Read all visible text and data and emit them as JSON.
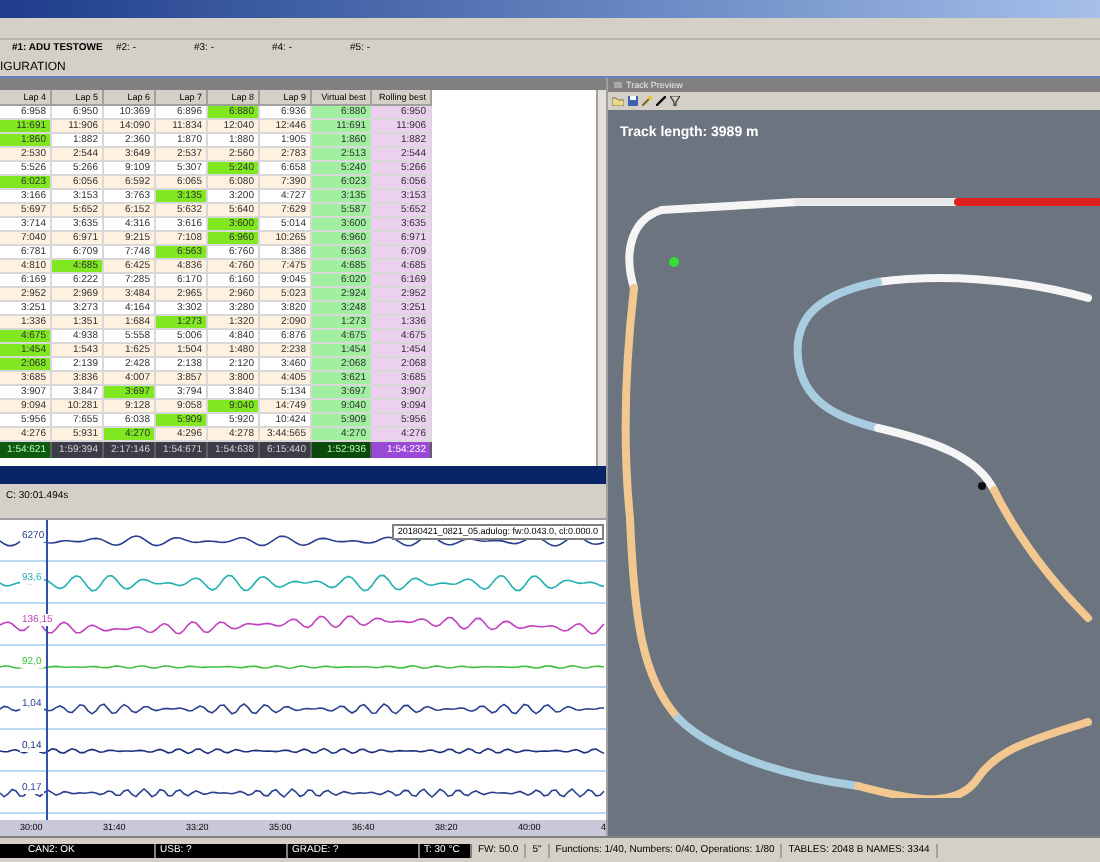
{
  "drivers": [
    "#1: ADU TESTOWE",
    "#2: -",
    "#3: -",
    "#4: -",
    "#5: -"
  ],
  "section_title": "IGURATION",
  "columns": [
    {
      "label": "Lap 4",
      "kind": "lap"
    },
    {
      "label": "Lap 5",
      "kind": "lap"
    },
    {
      "label": "Lap 6",
      "kind": "lap"
    },
    {
      "label": "Lap 7",
      "kind": "lap"
    },
    {
      "label": "Lap 8",
      "kind": "lap"
    },
    {
      "label": "Lap 9",
      "kind": "lap"
    },
    {
      "label": "Virtual best",
      "kind": "virtual"
    },
    {
      "label": "Rolling best",
      "kind": "rolling"
    }
  ],
  "rows": [
    {
      "cells": [
        "6:958",
        "6:950",
        "10:369",
        "6:896",
        "6:880",
        "6:936",
        "6:880",
        "6:950"
      ],
      "best": [
        false,
        false,
        false,
        false,
        true,
        false
      ]
    },
    {
      "cells": [
        "11:691",
        "11:906",
        "14:090",
        "11:834",
        "12:040",
        "12:446",
        "11:691",
        "11:906"
      ],
      "best": [
        true,
        false,
        false,
        false,
        false,
        false
      ]
    },
    {
      "cells": [
        "1:860",
        "1:882",
        "2:360",
        "1:870",
        "1:880",
        "1:905",
        "1:860",
        "1:882"
      ],
      "best": [
        true,
        false,
        false,
        false,
        false,
        false
      ]
    },
    {
      "cells": [
        "2:530",
        "2:544",
        "3:649",
        "2:537",
        "2:560",
        "2:783",
        "2:513",
        "2:544"
      ],
      "best": [
        false,
        false,
        false,
        false,
        false,
        false
      ]
    },
    {
      "cells": [
        "5:526",
        "5:266",
        "9:109",
        "5:307",
        "5:240",
        "6:658",
        "5:240",
        "5:266"
      ],
      "best": [
        false,
        false,
        false,
        false,
        true,
        false
      ]
    },
    {
      "cells": [
        "6:023",
        "6:056",
        "6:592",
        "6:065",
        "6:080",
        "7:390",
        "6:023",
        "6:056"
      ],
      "best": [
        true,
        false,
        false,
        false,
        false,
        false
      ]
    },
    {
      "cells": [
        "3:166",
        "3:153",
        "3:763",
        "3:135",
        "3:200",
        "4:727",
        "3:135",
        "3:153"
      ],
      "best": [
        false,
        false,
        false,
        true,
        false,
        false
      ]
    },
    {
      "cells": [
        "5:697",
        "5:652",
        "6:152",
        "5:632",
        "5:640",
        "7:629",
        "5:587",
        "5:652"
      ],
      "best": [
        false,
        false,
        false,
        false,
        false,
        false
      ]
    },
    {
      "cells": [
        "3:714",
        "3:635",
        "4:316",
        "3:616",
        "3:600",
        "5:014",
        "3:600",
        "3:635"
      ],
      "best": [
        false,
        false,
        false,
        false,
        true,
        false
      ]
    },
    {
      "cells": [
        "7:040",
        "6:971",
        "9:215",
        "7:108",
        "6:960",
        "10:265",
        "6:960",
        "6:971"
      ],
      "best": [
        false,
        false,
        false,
        false,
        true,
        false
      ]
    },
    {
      "cells": [
        "6:781",
        "6:709",
        "7:748",
        "6:563",
        "6:760",
        "8:386",
        "6:563",
        "6:709"
      ],
      "best": [
        false,
        false,
        false,
        true,
        false,
        false
      ]
    },
    {
      "cells": [
        "4:810",
        "4:685",
        "6:425",
        "4:836",
        "4:760",
        "7:475",
        "4:685",
        "4:685"
      ],
      "best": [
        false,
        true,
        false,
        false,
        false,
        false
      ]
    },
    {
      "cells": [
        "6:169",
        "6:222",
        "7:285",
        "6:170",
        "6:160",
        "9:045",
        "6:020",
        "6:169"
      ],
      "best": [
        false,
        false,
        false,
        false,
        false,
        false
      ]
    },
    {
      "cells": [
        "2:952",
        "2:969",
        "3:484",
        "2:965",
        "2:960",
        "5:023",
        "2:924",
        "2:952"
      ],
      "best": [
        false,
        false,
        false,
        false,
        false,
        false
      ]
    },
    {
      "cells": [
        "3:251",
        "3:273",
        "4:164",
        "3:302",
        "3:280",
        "3:820",
        "3:248",
        "3:251"
      ],
      "best": [
        false,
        false,
        false,
        false,
        false,
        false
      ]
    },
    {
      "cells": [
        "1:336",
        "1:351",
        "1:684",
        "1:273",
        "1:320",
        "2:090",
        "1:273",
        "1:336"
      ],
      "best": [
        false,
        false,
        false,
        true,
        false,
        false
      ]
    },
    {
      "cells": [
        "4:675",
        "4:938",
        "5:558",
        "5:006",
        "4:840",
        "6:876",
        "4:675",
        "4:675"
      ],
      "best": [
        true,
        false,
        false,
        false,
        false,
        false
      ]
    },
    {
      "cells": [
        "1:454",
        "1:543",
        "1:625",
        "1:504",
        "1:480",
        "2:238",
        "1:454",
        "1:454"
      ],
      "best": [
        true,
        false,
        false,
        false,
        false,
        false
      ]
    },
    {
      "cells": [
        "2:068",
        "2:139",
        "2:428",
        "2:138",
        "2:120",
        "3:460",
        "2:068",
        "2:068"
      ],
      "best": [
        true,
        false,
        false,
        false,
        false,
        false
      ]
    },
    {
      "cells": [
        "3:685",
        "3:836",
        "4:007",
        "3:857",
        "3:800",
        "4:405",
        "3:621",
        "3:685"
      ],
      "best": [
        false,
        false,
        false,
        false,
        false,
        false
      ]
    },
    {
      "cells": [
        "3:907",
        "3:847",
        "3:697",
        "3:794",
        "3:840",
        "5:134",
        "3:697",
        "3:907"
      ],
      "best": [
        false,
        false,
        true,
        false,
        false,
        false
      ]
    },
    {
      "cells": [
        "9:094",
        "10:281",
        "9:128",
        "9:058",
        "9:040",
        "14:749",
        "9:040",
        "9:094"
      ],
      "best": [
        false,
        false,
        false,
        false,
        true,
        false
      ]
    },
    {
      "cells": [
        "5:956",
        "7:655",
        "6:038",
        "5:909",
        "5:920",
        "10:424",
        "5:909",
        "5:956"
      ],
      "best": [
        false,
        false,
        false,
        true,
        false,
        false
      ]
    },
    {
      "cells": [
        "4:276",
        "5:931",
        "4:270",
        "4:296",
        "4:278",
        "3:44:565",
        "4:270",
        "4:276"
      ],
      "best": [
        false,
        false,
        true,
        false,
        false,
        false
      ]
    }
  ],
  "totals": [
    {
      "text": "1:54:621",
      "best": true
    },
    {
      "text": "1:59:394",
      "best": false
    },
    {
      "text": "2:17:146",
      "best": false
    },
    {
      "text": "1:54:671",
      "best": false
    },
    {
      "text": "1:54:638",
      "best": false
    },
    {
      "text": "6:15:440",
      "best": false
    },
    {
      "text": "1:52:936",
      "best": false
    },
    {
      "text": "1:54:232",
      "best": false
    }
  ],
  "graph": {
    "title": "C: 30:01.494s",
    "legend": "20180421_0821_05.adulog: fw:0.043.0, cl:0.000.0",
    "channels": [
      {
        "label": "6270",
        "color": "#2a3f8f"
      },
      {
        "label": "93,6",
        "color": "#22b0b0"
      },
      {
        "label": "136,15",
        "color": "#c040c0"
      },
      {
        "label": "92,0",
        "color": "#40c040"
      },
      {
        "label": "1,04",
        "color": "#2a3f8f"
      },
      {
        "label": "0,14",
        "color": "#1a2f7f"
      },
      {
        "label": "0,17",
        "color": "#2a3f8f"
      }
    ],
    "ticks": [
      "30:00",
      "31:40",
      "33:20",
      "35:00",
      "36:40",
      "38:20",
      "40:00",
      "4"
    ]
  },
  "track": {
    "title": "Track Preview",
    "length": "Track length: 3989 m"
  },
  "status": {
    "segments": [
      "CAN2: OK",
      "USB: ?",
      "GRADE: ?",
      "T:    30 °C"
    ],
    "info": [
      "FW: 50.0",
      "5\"",
      "Functions: 1/40, Numbers: 0/40, Operations: 1/80",
      "TABLES: 2048 B NAMES: 3344"
    ]
  }
}
